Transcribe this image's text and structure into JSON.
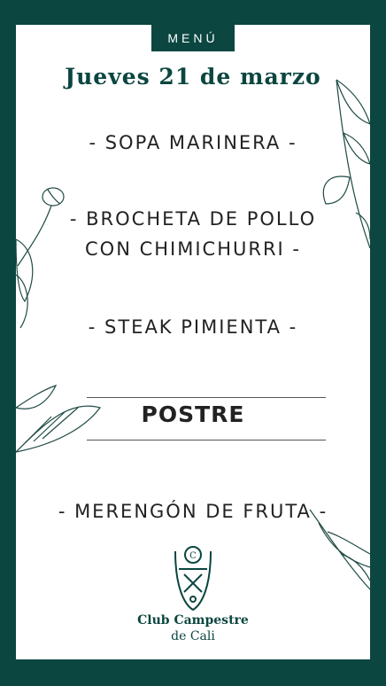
{
  "header": {
    "tab_label": "MENÚ",
    "date": "Jueves 21 de marzo"
  },
  "dishes": [
    {
      "line1": "- SOPA MARINERA -"
    },
    {
      "line1": "- BROCHETA DE POLLO",
      "line2": "CON CHIMICHURRI -"
    },
    {
      "line1": "- STEAK PIMIENTA -"
    }
  ],
  "dessert": {
    "heading": "POSTRE",
    "item": "- MERENGÓN DE FRUTA -"
  },
  "brand": {
    "name": "Club Campestre",
    "city": "de Cali"
  },
  "colors": {
    "primary": "#0b4640",
    "text": "#222222",
    "background": "#ffffff"
  },
  "icons": [
    "leaf-illustration-icon",
    "poppy-bud-icon",
    "club-crest-icon"
  ]
}
